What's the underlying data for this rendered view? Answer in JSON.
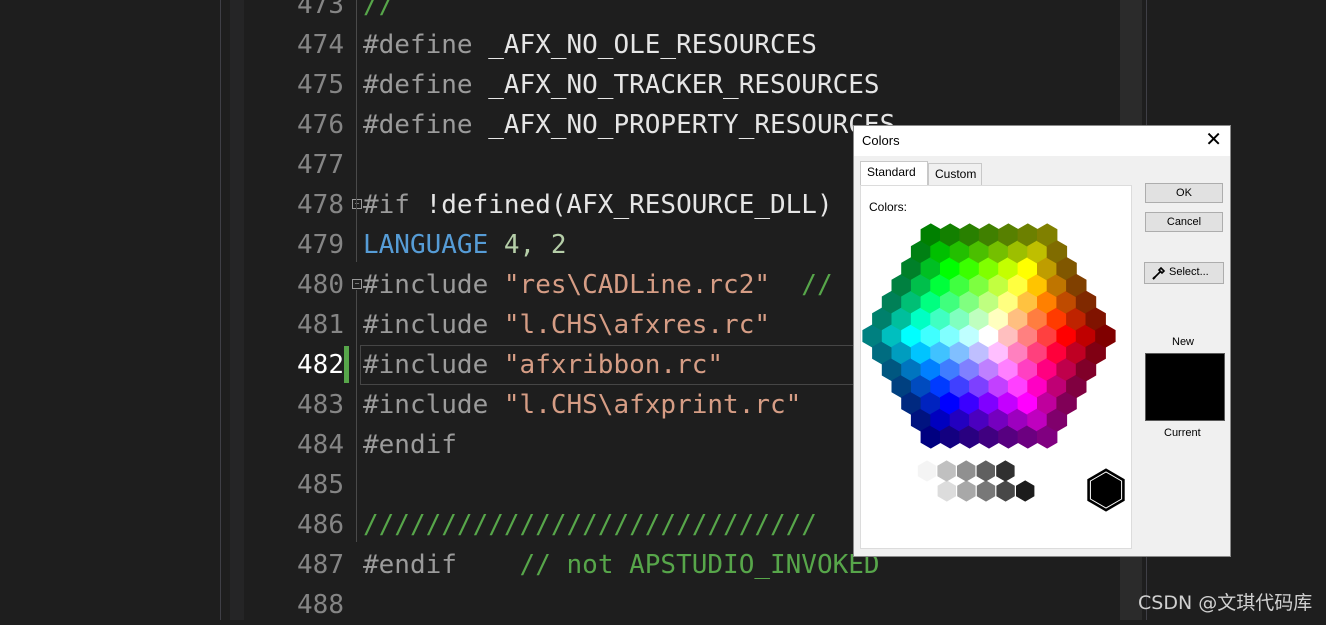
{
  "editor": {
    "lines": [
      {
        "num": "473",
        "parts": [
          {
            "t": "//",
            "c": "tk-cmt"
          }
        ]
      },
      {
        "num": "474",
        "parts": [
          {
            "t": "#define ",
            "c": "tk-pre"
          },
          {
            "t": "_AFX_NO_OLE_RESOURCES",
            "c": "tk-macro"
          }
        ]
      },
      {
        "num": "475",
        "parts": [
          {
            "t": "#define ",
            "c": "tk-pre"
          },
          {
            "t": "_AFX_NO_TRACKER_RESOURCES",
            "c": "tk-macro"
          }
        ]
      },
      {
        "num": "476",
        "parts": [
          {
            "t": "#define ",
            "c": "tk-pre"
          },
          {
            "t": "_AFX_NO_PROPERTY_RESOURCES",
            "c": "tk-macro"
          }
        ]
      },
      {
        "num": "477",
        "parts": []
      },
      {
        "num": "478",
        "fold": true,
        "parts": [
          {
            "t": "#if ",
            "c": "tk-pre"
          },
          {
            "t": "!defined(AFX_RESOURCE_DLL) ",
            "c": "tk-macro"
          }
        ]
      },
      {
        "num": "479",
        "parts": [
          {
            "t": "LANGUAGE ",
            "c": "tk-kw"
          },
          {
            "t": "4, 2",
            "c": "tk-num"
          }
        ]
      },
      {
        "num": "480",
        "fold": true,
        "parts": [
          {
            "t": "#include ",
            "c": "tk-pre"
          },
          {
            "t": "\"res\\CADLine.rc2\"",
            "c": "tk-str"
          },
          {
            "t": "  //",
            "c": "tk-cmt"
          }
        ]
      },
      {
        "num": "481",
        "parts": [
          {
            "t": "#include ",
            "c": "tk-pre"
          },
          {
            "t": "\"l.CHS\\afxres.rc\"",
            "c": "tk-str"
          }
        ]
      },
      {
        "num": "482",
        "active": true,
        "parts": [
          {
            "t": "#include ",
            "c": "tk-pre"
          },
          {
            "t": "\"afxribbon.rc\"",
            "c": "tk-str"
          }
        ]
      },
      {
        "num": "483",
        "parts": [
          {
            "t": "#include ",
            "c": "tk-pre"
          },
          {
            "t": "\"l.CHS\\afxprint.rc\"",
            "c": "tk-str"
          }
        ]
      },
      {
        "num": "484",
        "parts": [
          {
            "t": "#endif",
            "c": "tk-pre"
          }
        ]
      },
      {
        "num": "485",
        "parts": []
      },
      {
        "num": "486",
        "parts": [
          {
            "t": "/////////////////////////////",
            "c": "tk-cmt"
          }
        ]
      },
      {
        "num": "487",
        "parts": [
          {
            "t": "#endif    ",
            "c": "tk-pre"
          },
          {
            "t": "// not APSTUDIO_INVOKED",
            "c": "tk-cmt"
          }
        ]
      },
      {
        "num": "488",
        "parts": []
      }
    ]
  },
  "dialog": {
    "title": "Colors",
    "close_glyph": "✕",
    "tabs": [
      "Standard",
      "Custom"
    ],
    "colors_label": "Colors:",
    "ok_label": "OK",
    "cancel_label": "Cancel",
    "select_label": "Select...",
    "new_label": "New",
    "current_label": "Current",
    "new_color": "#000000",
    "icons": [
      "eyedropper-icon",
      "close-icon"
    ]
  },
  "watermark": "CSDN @文琪代码库"
}
